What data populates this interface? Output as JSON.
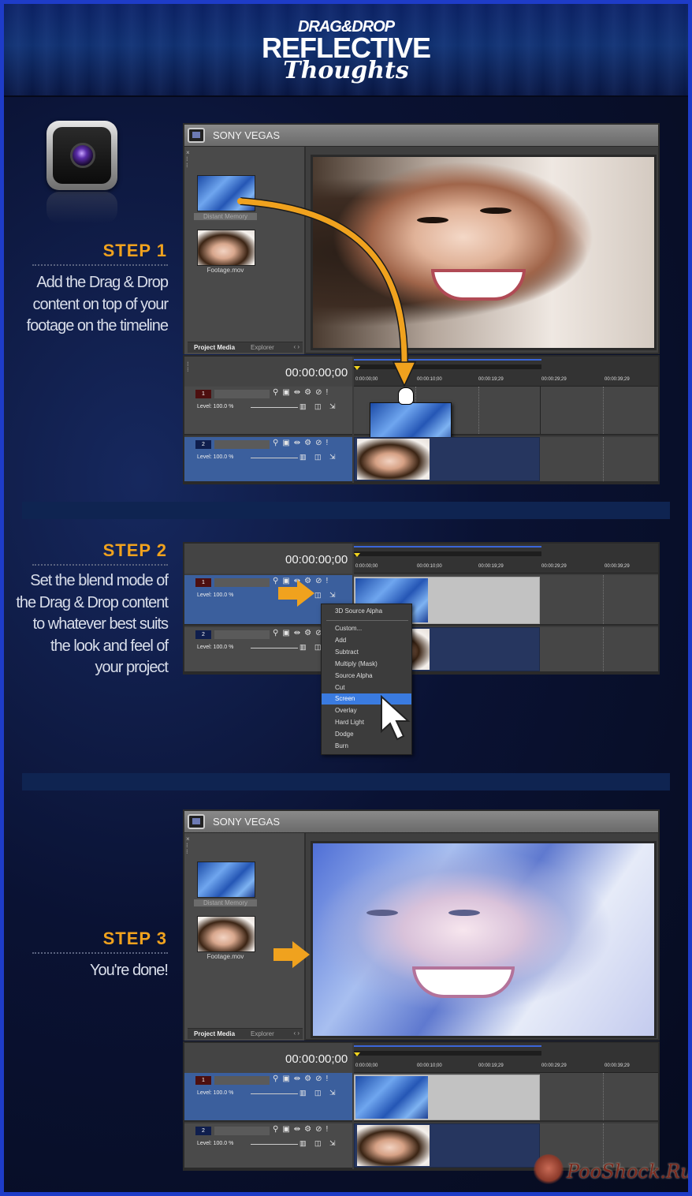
{
  "header": {
    "line1": "DRAG&DROP",
    "line2": "REFLECTIVE",
    "line3": "Thoughts"
  },
  "step1": {
    "title": "STEP 1",
    "text": [
      "Add the Drag & Drop",
      "content on top of your",
      "footage on the timeline"
    ]
  },
  "step2": {
    "title": "STEP 2",
    "text": [
      "Set the blend mode of",
      "the Drag & Drop content",
      "to whatever best suits",
      "the look and feel of",
      "your project"
    ]
  },
  "step3": {
    "title": "STEP 3",
    "text": [
      "You're done!"
    ]
  },
  "vegas": {
    "title": "SONY VEGAS",
    "media_items": [
      "Distant Memory",
      "Footage.mov"
    ],
    "tab_project_media": "Project Media",
    "tab_explorer": "Explorer",
    "timecode": "00:00:00;00",
    "ruler_ticks": [
      "0:00:00;00",
      "00:00:10;00",
      "00:00:19;29",
      "00:00:29;29",
      "00:00:39;29"
    ],
    "track1_number": "1",
    "track2_number": "2",
    "level_label": "Level: 100.0 %"
  },
  "blend_menu": {
    "items": [
      "3D Source Alpha",
      "Custom...",
      "Add",
      "Subtract",
      "Multiply (Mask)",
      "Source Alpha",
      "Cut",
      "Screen",
      "Overlay",
      "Hard Light",
      "Dodge",
      "Burn"
    ],
    "selected": "Screen"
  },
  "watermark": "PooShock.Ru",
  "colors": {
    "accent_orange": "#f0a21e",
    "frame_blue": "#1e3cc8",
    "menu_highlight": "#3a7be0"
  }
}
